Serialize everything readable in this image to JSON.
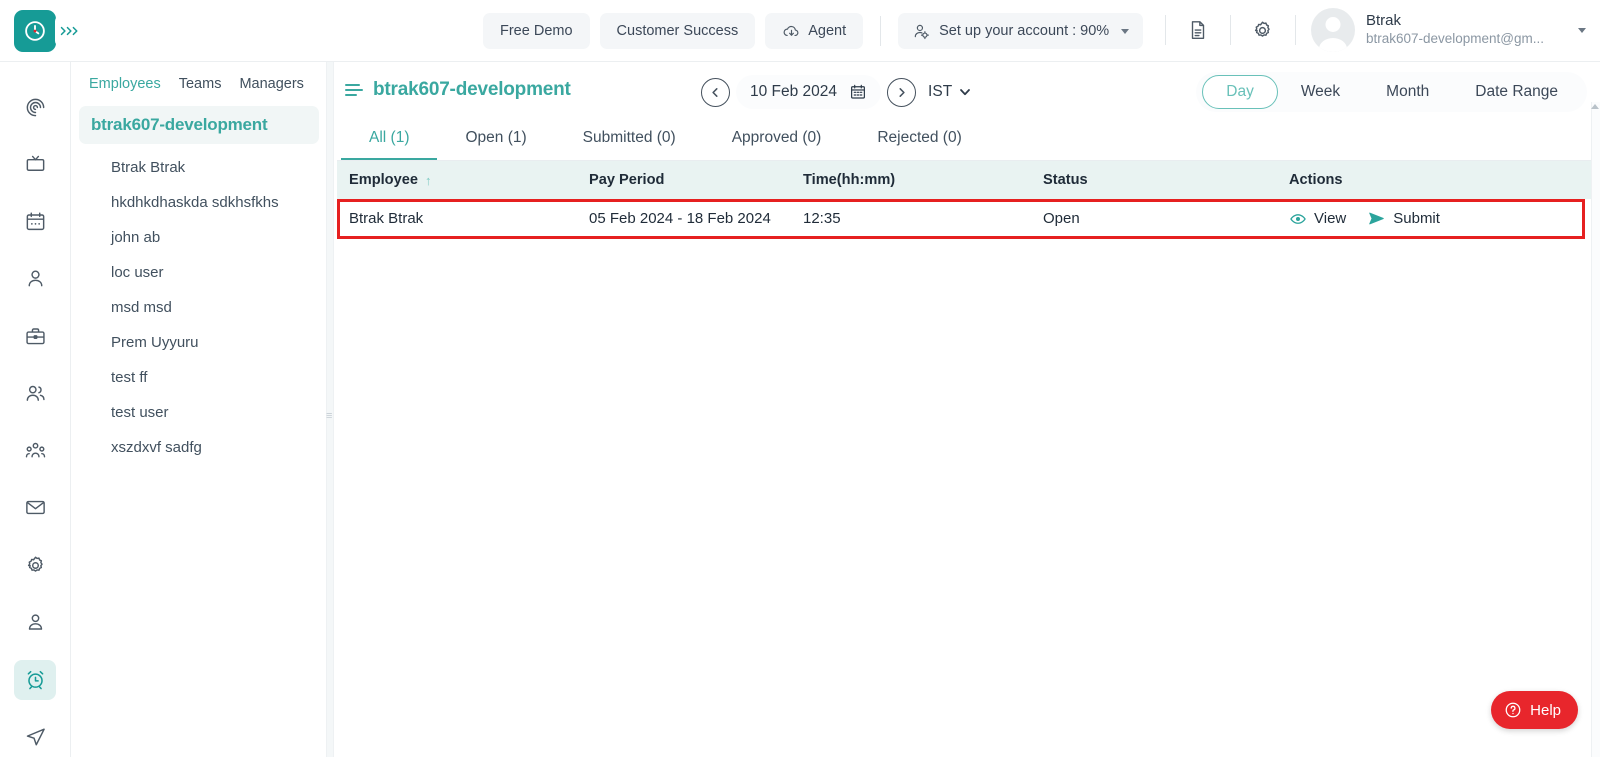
{
  "app": {
    "logo_icon": "clock-logo-icon",
    "collapse_icon": "chevrons-right-icon",
    "brand_color": "#169b96",
    "accent_color": "#3aa8a0",
    "highlight_color": "#e62020",
    "table_header_bg": "#e9f3f2"
  },
  "topbar": {
    "buttons": [
      {
        "label": "Free Demo",
        "icon": ""
      },
      {
        "label": "Customer Success",
        "icon": ""
      },
      {
        "label": "Agent",
        "icon": "cloud-download-icon"
      }
    ],
    "setup": {
      "label": "Set up your account : 90%",
      "icon": "user-settings-icon",
      "caret": "chevron-down-icon"
    },
    "doc_icon": "document-icon",
    "gear_icon": "gear-icon",
    "user": {
      "name": "Btrak",
      "email": "btrak607-development@gm...",
      "avatar": "avatar-placeholder",
      "caret": "chevron-down-icon"
    }
  },
  "rail": {
    "items": [
      {
        "name": "activity",
        "icon": "spiral-activity-icon",
        "active": false
      },
      {
        "name": "projects",
        "icon": "monitor-icon",
        "active": false
      },
      {
        "name": "calendar",
        "icon": "calendar-icon",
        "active": false
      },
      {
        "name": "employee",
        "icon": "user-icon",
        "active": false
      },
      {
        "name": "clients",
        "icon": "briefcase-icon",
        "active": false
      },
      {
        "name": "teams",
        "icon": "users-icon",
        "active": false
      },
      {
        "name": "org",
        "icon": "org-group-icon",
        "active": false
      },
      {
        "name": "mail",
        "icon": "mail-icon",
        "active": false
      },
      {
        "name": "settings",
        "icon": "gear-icon",
        "active": false
      },
      {
        "name": "profile",
        "icon": "user-badge-icon",
        "active": false
      },
      {
        "name": "timesheet",
        "icon": "alarm-clock-icon",
        "active": true
      },
      {
        "name": "send",
        "icon": "send-icon",
        "active": false
      }
    ]
  },
  "employee_panel": {
    "tabs": [
      {
        "label": "Employees",
        "active": true
      },
      {
        "label": "Teams",
        "active": false
      },
      {
        "label": "Managers",
        "active": false
      }
    ],
    "group_label": "btrak607-development",
    "employees": [
      "Btrak Btrak",
      "hkdhkdhaskda sdkhsfkhs",
      "john ab",
      "loc user",
      "msd msd",
      "Prem Uyyuru",
      "test ff",
      "test user",
      "xszdxvf sadfg"
    ]
  },
  "main": {
    "workspace_title": "btrak607-development",
    "menu_icon": "hamburger-icon",
    "date_nav": {
      "prev_icon": "chevron-left-circle-icon",
      "next_icon": "chevron-right-circle-icon",
      "date": "10 Feb 2024",
      "calendar_icon": "calendar-icon",
      "timezone": "IST",
      "timezone_caret": "chevron-down-icon"
    },
    "range_options": [
      {
        "label": "Day",
        "active": true
      },
      {
        "label": "Week",
        "active": false
      },
      {
        "label": "Month",
        "active": false
      },
      {
        "label": "Date Range",
        "active": false
      }
    ],
    "status_tabs": [
      {
        "label": "All (1)",
        "active": true
      },
      {
        "label": "Open (1)",
        "active": false
      },
      {
        "label": "Submitted (0)",
        "active": false
      },
      {
        "label": "Approved (0)",
        "active": false
      },
      {
        "label": "Rejected (0)",
        "active": false
      }
    ],
    "table": {
      "columns": [
        {
          "label": "Employee",
          "sort": "asc"
        },
        {
          "label": "Pay Period",
          "sort": ""
        },
        {
          "label": "Time(hh:mm)",
          "sort": ""
        },
        {
          "label": "Status",
          "sort": ""
        },
        {
          "label": "Actions",
          "sort": ""
        }
      ],
      "rows": [
        {
          "employee": "Btrak Btrak",
          "pay_period": "05 Feb 2024 - 18 Feb 2024",
          "time": "12:35",
          "status": "Open",
          "actions": [
            {
              "label": "View",
              "icon": "eye-icon"
            },
            {
              "label": "Submit",
              "icon": "send-icon"
            }
          ]
        }
      ]
    }
  },
  "help": {
    "label": "Help",
    "icon": "question-circle-icon"
  }
}
